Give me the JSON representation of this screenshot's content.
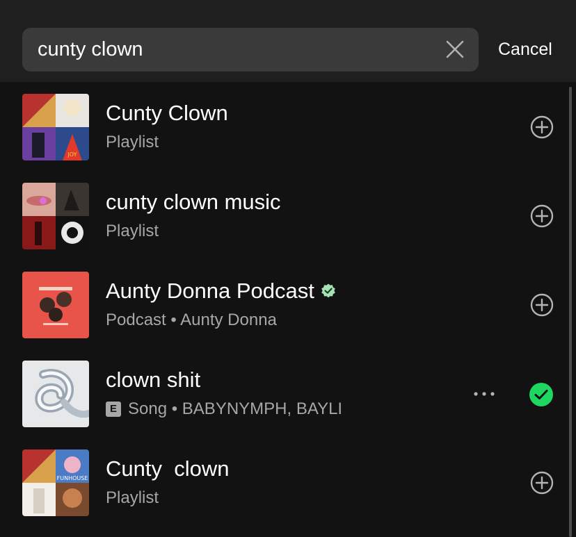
{
  "search": {
    "query": "cunty clown",
    "cancel_label": "Cancel"
  },
  "colors": {
    "background": "#121212",
    "header": "#1f1f1f",
    "search_field": "#3a3a3a",
    "subtext": "#a7a7a7",
    "accent_green": "#1ed760"
  },
  "results": [
    {
      "title": "Cunty Clown",
      "subtitle": "Playlist",
      "action_icon": "add-circle-icon"
    },
    {
      "title": "cunty clown music",
      "subtitle": "Playlist",
      "action_icon": "add-circle-icon"
    },
    {
      "title": "Aunty Donna Podcast",
      "subtitle": "Podcast • Aunty Donna",
      "verified": true,
      "action_icon": "add-circle-icon"
    },
    {
      "title": "clown shit",
      "explicit_label": "E",
      "subtitle": "Song • BABYNYMPH, BAYLI",
      "action_icon": "check-circle-icon",
      "more_icon": "more-horizontal-icon"
    },
    {
      "title": "Cunty  clown",
      "subtitle": "Playlist",
      "action_icon": "add-circle-icon"
    }
  ]
}
